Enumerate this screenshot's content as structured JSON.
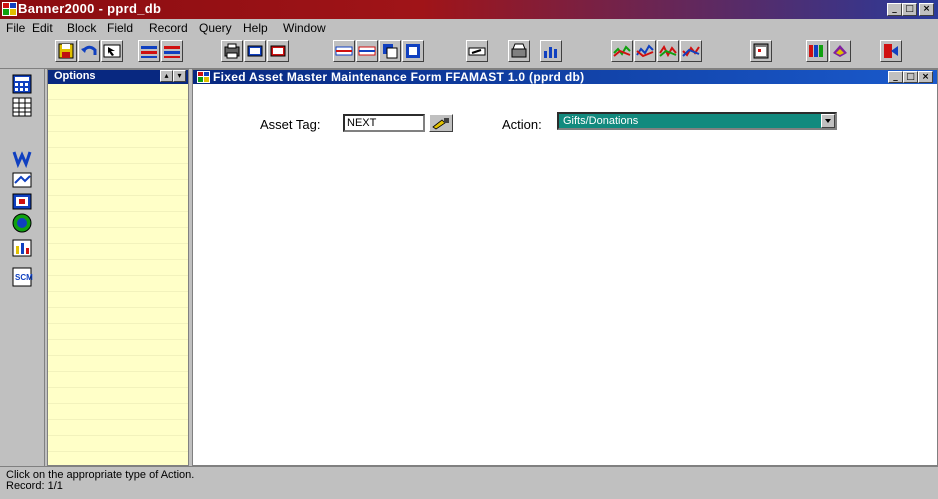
{
  "app": {
    "title": "Banner2000 - pprd_db"
  },
  "menu": [
    {
      "label": "File",
      "key": "F"
    },
    {
      "label": "Edit",
      "key": "E"
    },
    {
      "label": "Block",
      "key": "B"
    },
    {
      "label": "Field",
      "key": "F"
    },
    {
      "label": "Record",
      "key": "R"
    },
    {
      "label": "Query",
      "key": "Q"
    },
    {
      "label": "Help",
      "key": "H"
    },
    {
      "label": "Window",
      "key": "W"
    }
  ],
  "toolbar": {
    "buttons": [
      "save-icon",
      "undo-icon",
      "exit-icon",
      "insert-record-icon",
      "remove-record-icon",
      "print-icon",
      "rollback-icon",
      "save-record-icon",
      "previous-block-icon",
      "next-block-icon",
      "duplicate-icon",
      "clear-icon",
      "edit-icon",
      "print-form-icon",
      "chart-icon",
      "query-1-icon",
      "query-2-icon",
      "query-3-icon",
      "query-4-icon",
      "calendar-icon",
      "calculator-icon",
      "list-icon",
      "exit-app-icon"
    ]
  },
  "left_strip": {
    "icons": [
      "calculator-icon",
      "spreadsheet-icon",
      "finance-icon",
      "tools-icon",
      "screen-icon",
      "globe-icon",
      "report-icon",
      "scm-icon"
    ]
  },
  "options_panel": {
    "title": "Options"
  },
  "form": {
    "title": "Fixed Asset Master Maintenance Form  FFAMAST  1.0  (pprd db)",
    "asset_tag_label": "Asset Tag:",
    "asset_tag_value": "NEXT",
    "action_label": "Action:",
    "action_value": "Gifts/Donations"
  },
  "status": {
    "hint": "Click on the appropriate type of Action.",
    "record": "Record: 1/1"
  },
  "colors": {
    "title_active": "#082880",
    "options_bg": "#ffffc8",
    "action_select_bg": "#128a7e"
  }
}
